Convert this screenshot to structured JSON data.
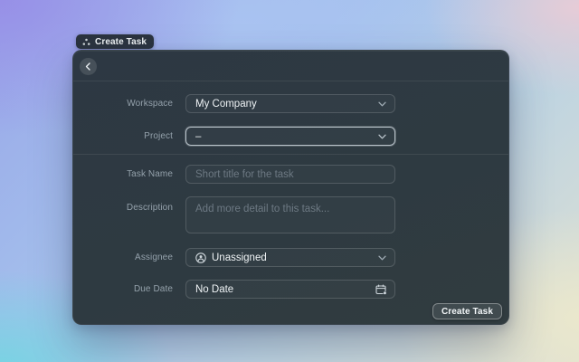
{
  "colors": {
    "panel": "#2d3842",
    "focus_border": "#b9c3ca",
    "text": "#eef2f4",
    "label": "#94a1ab"
  },
  "launcher_badge": {
    "icon": "command-dots-icon",
    "label": "Create Task"
  },
  "window": {
    "header": {
      "back_icon": "chevron-left-icon"
    },
    "form": {
      "workspace": {
        "label": "Workspace",
        "value": "My Company"
      },
      "project": {
        "label": "Project",
        "value": "–"
      },
      "task_name": {
        "label": "Task Name",
        "value": "",
        "placeholder": "Short title for the task"
      },
      "description": {
        "label": "Description",
        "value": "",
        "placeholder": "Add more detail to this task..."
      },
      "assignee": {
        "label": "Assignee",
        "value": "Unassigned",
        "icon": "person-circle-icon"
      },
      "due_date": {
        "label": "Due Date",
        "value": "No Date",
        "icon": "calendar-plus-icon"
      }
    },
    "footer": {
      "submit_label": "Create Task"
    }
  }
}
